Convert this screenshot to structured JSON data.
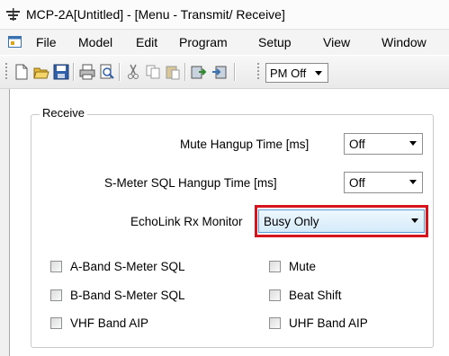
{
  "window": {
    "title": "MCP-2A[Untitled] - [Menu - Transmit/ Receive]"
  },
  "menubar": {
    "items": [
      "File",
      "Model",
      "Edit",
      "Program",
      "Setup",
      "View",
      "Window"
    ]
  },
  "toolbar": {
    "buttons": [
      "new-icon",
      "open-icon",
      "save-icon",
      "print-icon",
      "print-preview-icon",
      "cut-icon",
      "copy-icon",
      "paste-icon",
      "read-from-radio-icon",
      "write-to-radio-icon"
    ],
    "pm_select": {
      "value": "PM Off"
    }
  },
  "receive": {
    "caption": "Receive",
    "mute_hangup": {
      "label": "Mute Hangup Time [ms]",
      "value": "Off"
    },
    "smeter_sql_hangup": {
      "label": "S-Meter SQL Hangup Time [ms]",
      "value": "Off"
    },
    "echolink_monitor": {
      "label": "EchoLink Rx Monitor",
      "value": "Busy Only"
    },
    "checkboxes": [
      {
        "label": "A-Band S-Meter SQL",
        "checked": false
      },
      {
        "label": "Mute",
        "checked": false
      },
      {
        "label": "B-Band S-Meter SQL",
        "checked": false
      },
      {
        "label": "Beat Shift",
        "checked": false
      },
      {
        "label": "VHF Band AIP",
        "checked": false
      },
      {
        "label": "UHF Band AIP",
        "checked": false
      }
    ]
  },
  "colors": {
    "highlight": "#d6141d",
    "selected_combo_border": "#5b9bd5"
  }
}
